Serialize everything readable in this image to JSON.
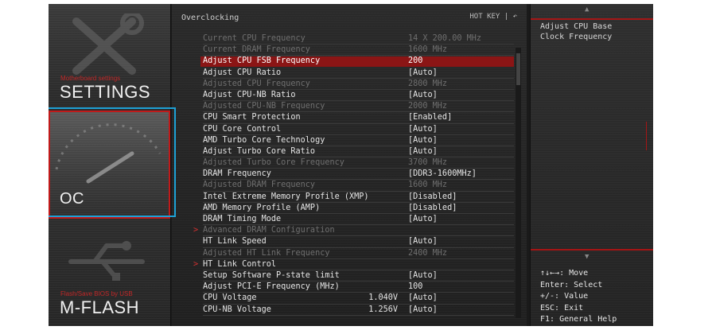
{
  "nav": {
    "settings": {
      "sub": "Motherboard settings",
      "main": "SETTINGS"
    },
    "oc": {
      "main": "OC"
    },
    "mflash": {
      "sub": "Flash/Save BIOS by USB",
      "main": "M-FLASH"
    }
  },
  "center": {
    "title": "Overclocking",
    "hotkey": "HOT KEY  |  ↶",
    "rows": [
      {
        "label": "Current CPU Frequency",
        "mid": "",
        "value": "14 X 200.00 MHz",
        "style": "dim"
      },
      {
        "label": "Current DRAM Frequency",
        "mid": "",
        "value": "1600 MHz",
        "style": "dim"
      },
      {
        "label": "Adjust CPU FSB Frequency",
        "mid": "",
        "value": "200",
        "style": "sel"
      },
      {
        "label": "Adjust CPU Ratio",
        "mid": "",
        "value": "[Auto]",
        "style": "norm"
      },
      {
        "label": "Adjusted CPU Frequency",
        "mid": "",
        "value": "2800 MHz",
        "style": "dim"
      },
      {
        "label": "Adjust CPU-NB Ratio",
        "mid": "",
        "value": "[Auto]",
        "style": "norm"
      },
      {
        "label": "Adjusted CPU-NB Frequency",
        "mid": "",
        "value": "2000 MHz",
        "style": "dim"
      },
      {
        "label": "CPU Smart Protection",
        "mid": "",
        "value": "[Enabled]",
        "style": "norm"
      },
      {
        "label": "CPU Core Control",
        "mid": "",
        "value": "[Auto]",
        "style": "norm"
      },
      {
        "label": "AMD Turbo Core Technology",
        "mid": "",
        "value": "[Auto]",
        "style": "norm"
      },
      {
        "label": "Adjust Turbo Core Ratio",
        "mid": "",
        "value": "[Auto]",
        "style": "norm"
      },
      {
        "label": "Adjusted Turbo Core Frequency",
        "mid": "",
        "value": "3700 MHz",
        "style": "dim"
      },
      {
        "label": "DRAM Frequency",
        "mid": "",
        "value": "[DDR3-1600MHz]",
        "style": "norm"
      },
      {
        "label": "Adjusted DRAM Frequency",
        "mid": "",
        "value": "1600 MHz",
        "style": "dim"
      },
      {
        "label": "Intel Extreme Memory Profile (XMP)",
        "mid": "",
        "value": "[Disabled]",
        "style": "norm"
      },
      {
        "label": "AMD Memory Profile (AMP)",
        "mid": "",
        "value": "[Disabled]",
        "style": "norm"
      },
      {
        "label": "DRAM Timing Mode",
        "mid": "",
        "value": "[Auto]",
        "style": "norm"
      },
      {
        "label": "Advanced DRAM Configuration",
        "mid": "",
        "value": "",
        "style": "dim",
        "submenu": true
      },
      {
        "label": "HT Link Speed",
        "mid": "",
        "value": "[Auto]",
        "style": "norm"
      },
      {
        "label": "Adjusted HT Link Frequency",
        "mid": "",
        "value": "2400 MHz",
        "style": "dim"
      },
      {
        "label": "HT Link Control",
        "mid": "",
        "value": "",
        "style": "norm",
        "submenu": true
      },
      {
        "label": "Setup Software P-state limit",
        "mid": "",
        "value": "[Auto]",
        "style": "norm"
      },
      {
        "label": "Adjust PCI-E Frequency (MHz)",
        "mid": "",
        "value": "100",
        "style": "norm"
      },
      {
        "label": "CPU Voltage",
        "mid": "1.040V",
        "value": "[Auto]",
        "style": "norm"
      },
      {
        "label": "CPU-NB Voltage",
        "mid": "1.256V",
        "value": "[Auto]",
        "style": "norm"
      }
    ]
  },
  "help": {
    "text_line1": "Adjust CPU Base",
    "text_line2": "Clock Frequency",
    "keys": [
      "↑↓←→: Move",
      "Enter: Select",
      "+/-: Value",
      "ESC: Exit",
      "F1: General Help"
    ]
  },
  "colors": {
    "accent_red": "#a51515",
    "highlight": "#8b1515",
    "focus_frame": "#1ea1d6"
  }
}
